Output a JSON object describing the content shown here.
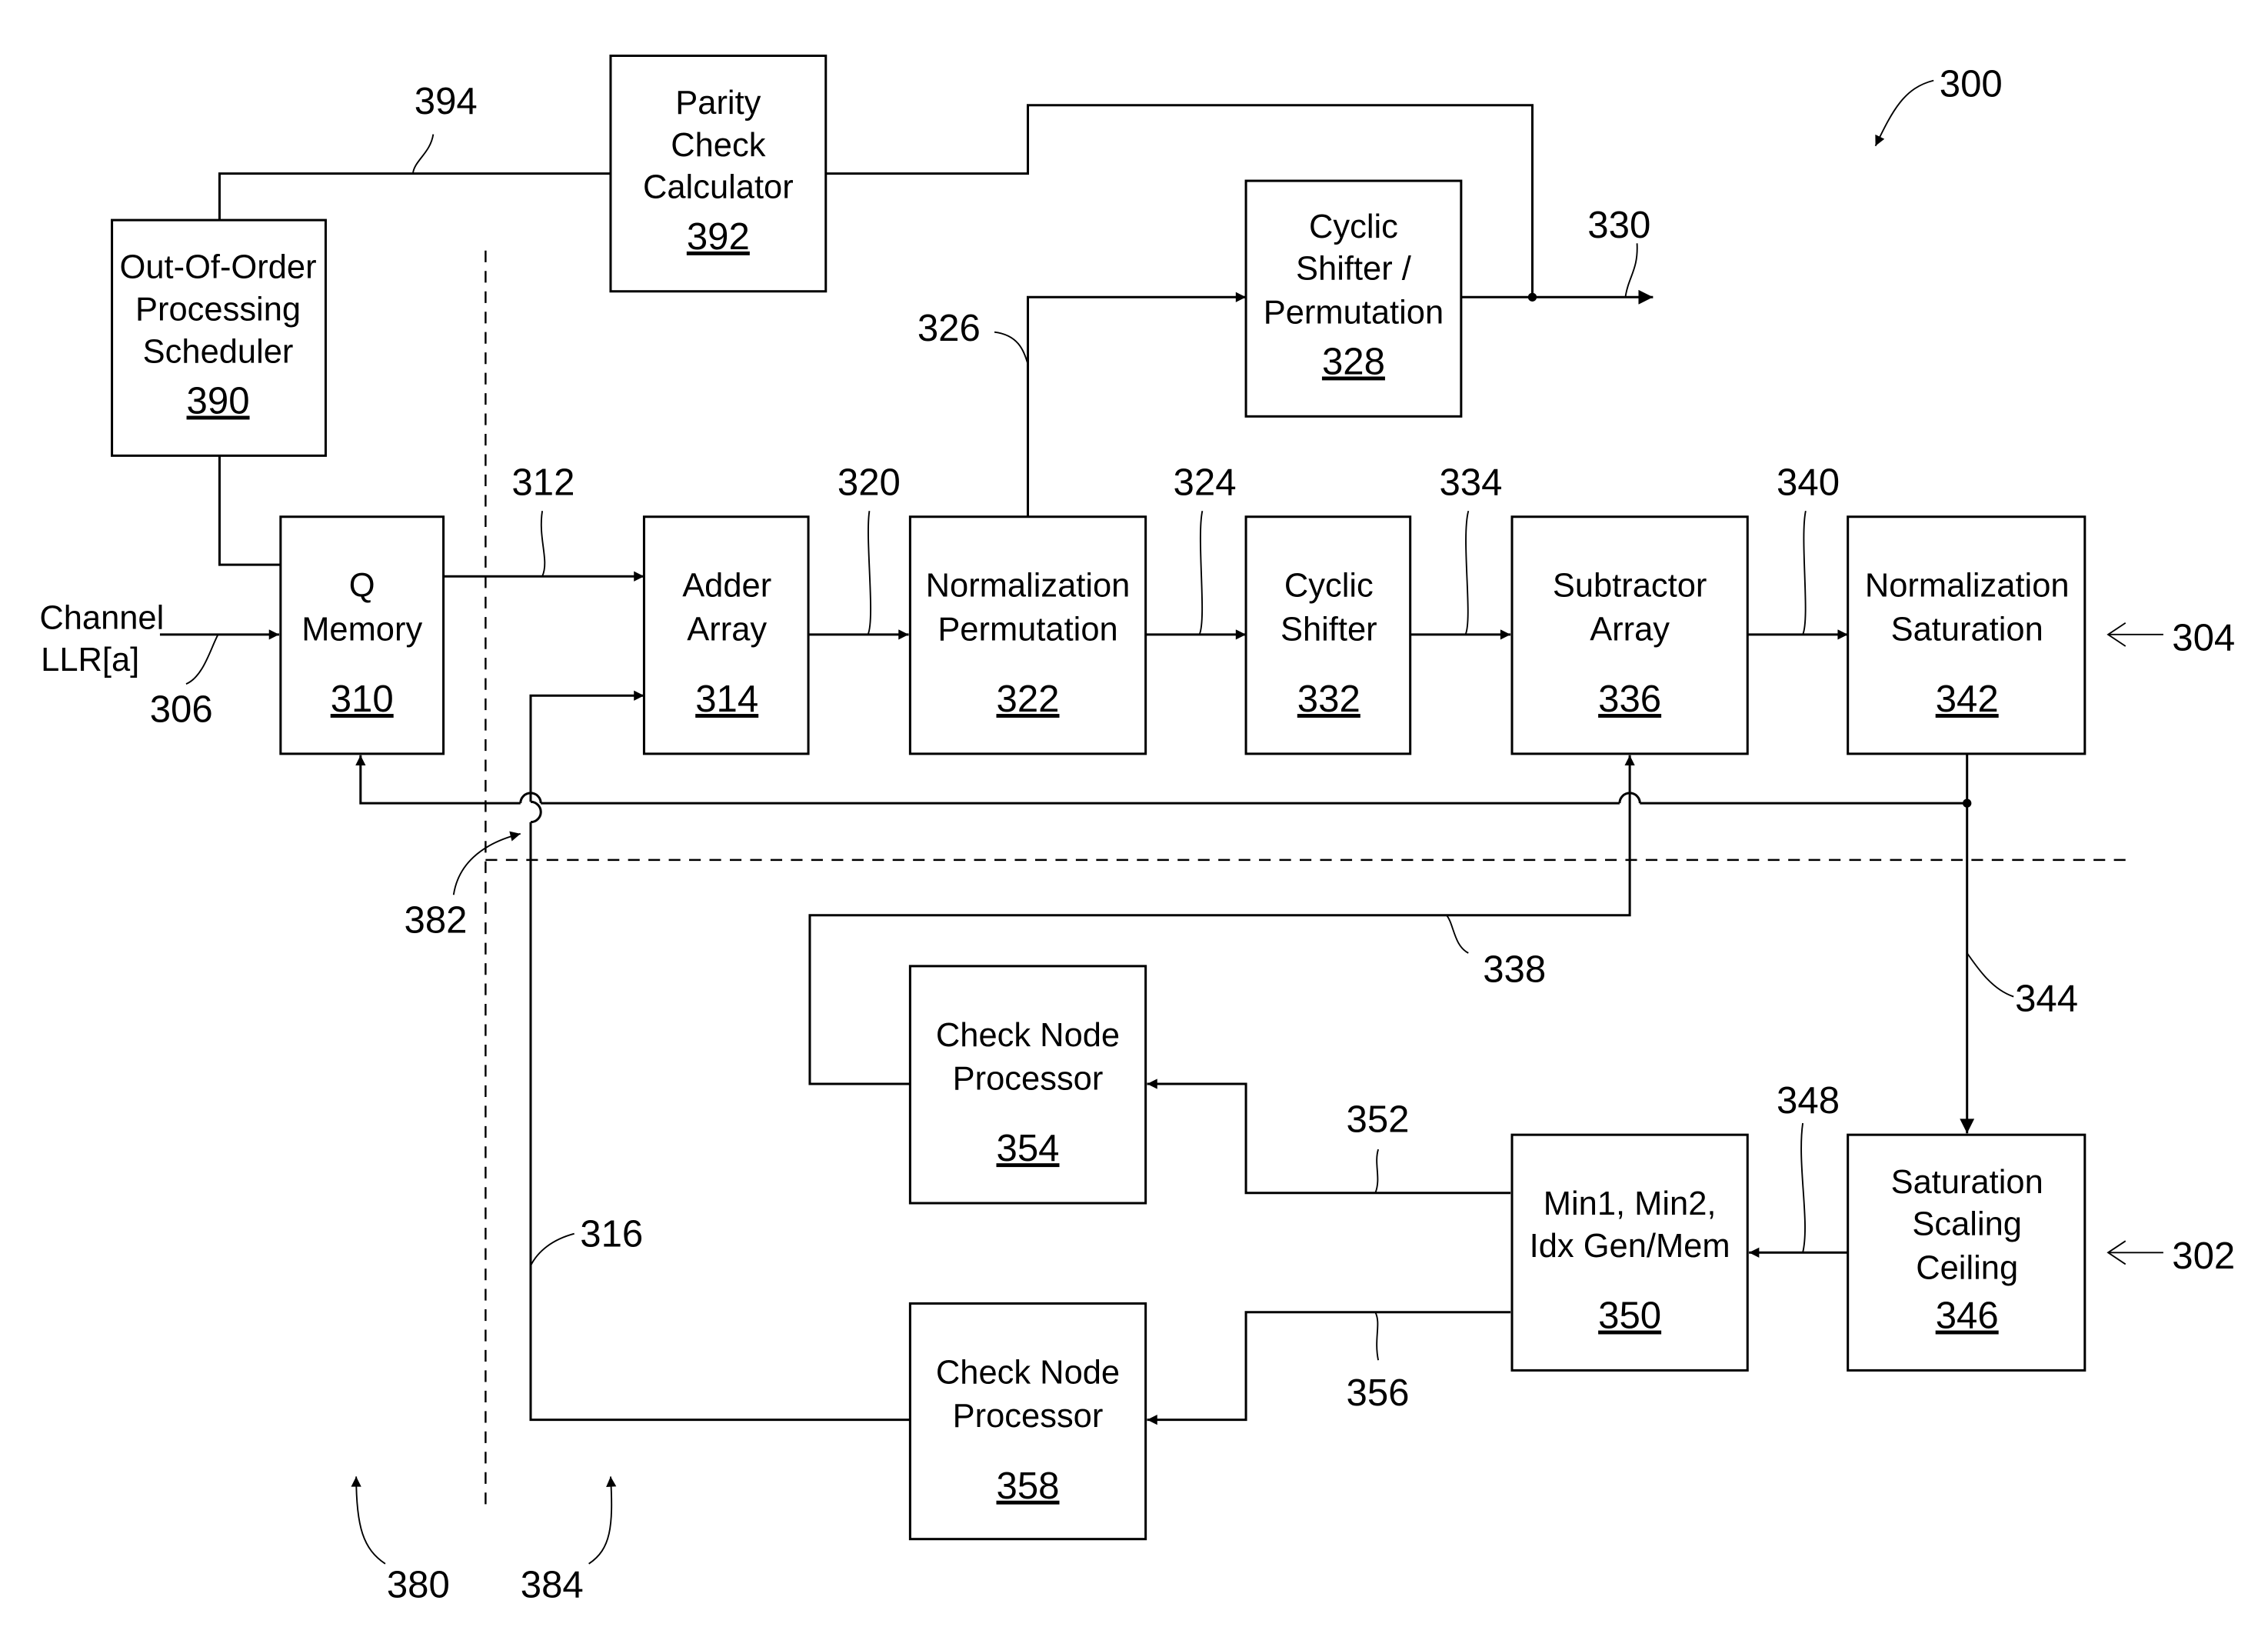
{
  "figure_ref": "300",
  "blocks": {
    "parity": {
      "lines": [
        "Parity",
        "Check",
        "Calculator"
      ],
      "num": "392"
    },
    "ooo": {
      "lines": [
        "Out-Of-Order",
        "Processing",
        "Scheduler"
      ],
      "num": "390"
    },
    "qmem": {
      "lines": [
        "Q",
        "Memory"
      ],
      "num": "310"
    },
    "adder": {
      "lines": [
        "Adder",
        "Array"
      ],
      "num": "314"
    },
    "normperm": {
      "lines": [
        "Normalization",
        "Permutation"
      ],
      "num": "322"
    },
    "cyclic": {
      "lines": [
        "Cyclic",
        "Shifter"
      ],
      "num": "332"
    },
    "subtractor": {
      "lines": [
        "Subtractor",
        "Array"
      ],
      "num": "336"
    },
    "normsat": {
      "lines": [
        "Normalization",
        "Saturation"
      ],
      "num": "342"
    },
    "cycperm": {
      "lines": [
        "Cyclic",
        "Shifter /",
        "Permutation"
      ],
      "num": "328"
    },
    "cnp1": {
      "lines": [
        "Check Node",
        "Processor"
      ],
      "num": "354"
    },
    "cnp2": {
      "lines": [
        "Check Node",
        "Processor"
      ],
      "num": "358"
    },
    "minidx": {
      "lines": [
        "Min1, Min2,",
        "Idx Gen/Mem"
      ],
      "num": "350"
    },
    "satscale": {
      "lines": [
        "Saturation",
        "Scaling",
        "Ceiling"
      ],
      "num": "346"
    }
  },
  "input_label": [
    "Channel",
    "LLR[a]"
  ],
  "refs": {
    "r394": "394",
    "r330": "330",
    "r326": "326",
    "r312": "312",
    "r320": "320",
    "r324": "324",
    "r334": "334",
    "r340": "340",
    "r304": "304",
    "r306": "306",
    "r382": "382",
    "r338": "338",
    "r344": "344",
    "r348": "348",
    "r352": "352",
    "r316": "316",
    "r302": "302",
    "r356": "356",
    "r380": "380",
    "r384": "384"
  }
}
